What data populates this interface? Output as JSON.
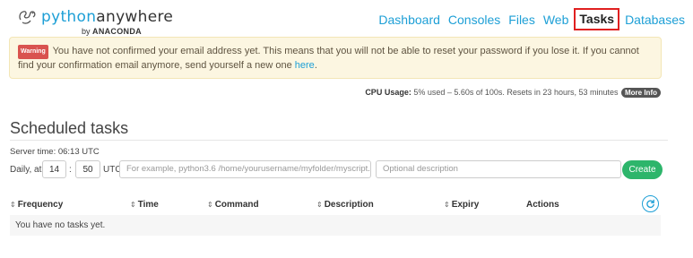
{
  "logo": {
    "part1": "python",
    "part2": "anywhere",
    "by": "by",
    "company": "ANACONDA"
  },
  "nav": {
    "items": [
      "Dashboard",
      "Consoles",
      "Files",
      "Web",
      "Tasks",
      "Databases"
    ],
    "active": "Tasks"
  },
  "alert": {
    "badge": "Warning",
    "text": "You have not confirmed your email address yet. This means that you will not be able to reset your password if you lose it. If you cannot find your confirmation email anymore, send yourself a new one",
    "link": "here",
    "end": "."
  },
  "cpu": {
    "label": "CPU Usage:",
    "value": "5% used – 5.60s of 100s. Resets in 23 hours, 53 minutes",
    "more_info": "More Info"
  },
  "page_title": "Scheduled tasks",
  "server_time": "Server time: 06:13 UTC",
  "form": {
    "daily_label": "Daily, at",
    "hour": "14",
    "colon": ":",
    "minute": "50",
    "utc": "UTC",
    "command_placeholder": "For example, python3.6 /home/yourusername/myfolder/myscript.py",
    "description_placeholder": "Optional description",
    "create": "Create"
  },
  "table": {
    "sort_glyph": "⇕",
    "headers": [
      "Frequency",
      "Time",
      "Command",
      "Description",
      "Expiry",
      "Actions"
    ],
    "empty": "You have no tasks yet."
  },
  "colors": {
    "brand_blue": "#1d9fd6",
    "create_green": "#2db56b",
    "warning_red": "#d9534f",
    "active_outline": "#e02020"
  }
}
